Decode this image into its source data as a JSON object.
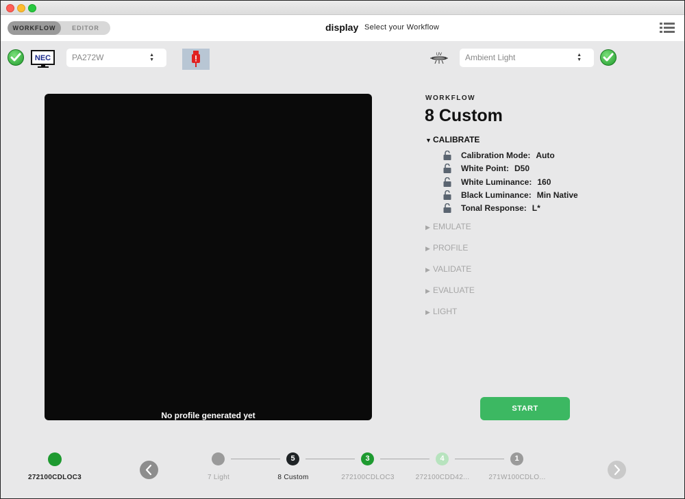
{
  "header": {
    "tabs": [
      {
        "label": "WORKFLOW",
        "active": true
      },
      {
        "label": "EDITOR",
        "active": false
      }
    ],
    "app_title": "display",
    "subtitle": "Select your Workflow"
  },
  "toolbar": {
    "nec_logo": "NEC",
    "display_select": {
      "value": "PA272W"
    },
    "ambient_select": {
      "value": "Ambient Light"
    },
    "uv_label": "UV",
    "icons": {
      "left_status": "check-circle-icon",
      "right_status": "check-circle-icon",
      "usb": "usb-warning-icon",
      "menu": "list-menu-icon"
    }
  },
  "preview": {
    "caption": "No profile generated yet"
  },
  "workflow": {
    "label": "WORKFLOW",
    "name": "8 Custom",
    "sections": [
      {
        "title": "CALIBRATE",
        "expanded": true,
        "settings": [
          {
            "key": "Calibration Mode:",
            "value": "Auto"
          },
          {
            "key": "White Point:",
            "value": "D50"
          },
          {
            "key": "White Luminance:",
            "value": "160"
          },
          {
            "key": "Black Luminance:",
            "value": "Min Native"
          },
          {
            "key": "Tonal Response:",
            "value": "L*"
          }
        ]
      },
      {
        "title": "EMULATE",
        "expanded": false
      },
      {
        "title": "PROFILE",
        "expanded": false
      },
      {
        "title": "VALIDATE",
        "expanded": false
      },
      {
        "title": "EVALUATE",
        "expanded": false
      },
      {
        "title": "LIGHT",
        "expanded": false
      }
    ],
    "start_label": "START"
  },
  "footer": {
    "device": {
      "label": "272100CDLOC3",
      "color": "#1e9a30"
    },
    "steps": [
      {
        "number": "",
        "label": "7 Light",
        "color": "#9a9a9a",
        "state": "inactive"
      },
      {
        "number": "5",
        "label": "8 Custom",
        "color": "#1f2326",
        "state": "current"
      },
      {
        "number": "3",
        "label": "272100CDLOC3",
        "color": "#1e9a30",
        "state": "inactive"
      },
      {
        "number": "4",
        "label": "272100CDD42...",
        "color": "#b7e3be",
        "state": "inactive"
      },
      {
        "number": "1",
        "label": "271W100CDLO...",
        "color": "#9a9a9a",
        "state": "inactive"
      }
    ]
  }
}
